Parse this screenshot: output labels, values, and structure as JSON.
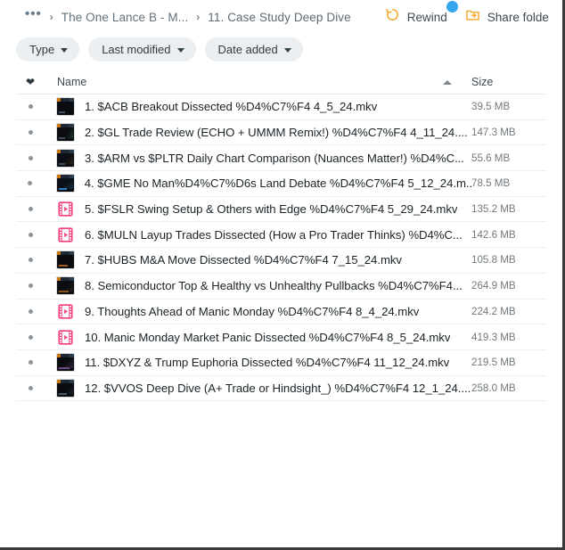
{
  "breadcrumb": {
    "overflow_icon": "ellipsis-icon",
    "separator": "›",
    "items": [
      {
        "label": "The One Lance B - M..."
      },
      {
        "label": "11. Case Study Deep Dive"
      }
    ]
  },
  "toolbar": {
    "rewind": {
      "label": "Rewind",
      "icon": "rewind-circular-arrow-icon",
      "color": "#F5A623",
      "has_badge": true,
      "badge_color": "#35A6EF"
    },
    "share_folder": {
      "label": "Share folde",
      "icon": "share-folder-icon",
      "color": "#F5A623"
    }
  },
  "filters": [
    {
      "label": "Type",
      "icon": "chevron-down-icon"
    },
    {
      "label": "Last modified",
      "icon": "chevron-down-icon"
    },
    {
      "label": "Date added",
      "icon": "chevron-down-icon"
    }
  ],
  "table": {
    "columns": {
      "favorite_icon": "heart-icon",
      "name": "Name",
      "sort_icon": "chevron-up-icon",
      "size": "Size"
    },
    "rows": [
      {
        "name": "1. $ACB Breakout Dissected %D4%C7%F4 4_5_24.mkv",
        "size": "39.5 MB",
        "icon": "video-thumbnail",
        "variant": "v1"
      },
      {
        "name": "2. $GL Trade Review (ECHO + UMMM Remix!) %D4%C7%F4 4_11_24....",
        "size": "147.3 MB",
        "icon": "video-thumbnail",
        "variant": "v2"
      },
      {
        "name": "3. $ARM vs $PLTR Daily Chart Comparison (Nuances Matter!) %D4%C...",
        "size": "55.6 MB",
        "icon": "video-thumbnail",
        "variant": "v3"
      },
      {
        "name": "4. $GME No Man%D4%C7%D6s Land Debate %D4%C7%F4 5_12_24.m...",
        "size": "78.5 MB",
        "icon": "video-thumbnail",
        "variant": "v4"
      },
      {
        "name": "5. $FSLR Swing Setup & Others with Edge %D4%C7%F4 5_29_24.mkv",
        "size": "135.2 MB",
        "icon": "video-file-icon",
        "variant": "film"
      },
      {
        "name": "6. $MULN Layup Trades Dissected (How a Pro Trader Thinks) %D4%C...",
        "size": "142.6 MB",
        "icon": "video-file-icon",
        "variant": "film"
      },
      {
        "name": "7. $HUBS M&A Move Dissected %D4%C7%F4 7_15_24.mkv",
        "size": "105.8 MB",
        "icon": "video-thumbnail",
        "variant": "v7"
      },
      {
        "name": "8. Semiconductor Top & Healthy vs Unhealthy Pullbacks %D4%C7%F4...",
        "size": "264.9 MB",
        "icon": "video-thumbnail",
        "variant": "v8"
      },
      {
        "name": "9. Thoughts Ahead of Manic Monday %D4%C7%F4 8_4_24.mkv",
        "size": "224.2 MB",
        "icon": "video-file-icon",
        "variant": "film"
      },
      {
        "name": "10. Manic Monday Market Panic Dissected %D4%C7%F4 8_5_24.mkv",
        "size": "419.3 MB",
        "icon": "video-file-icon",
        "variant": "film"
      },
      {
        "name": "11. $DXYZ & Trump Euphoria Dissected %D4%C7%F4 11_12_24.mkv",
        "size": "219.5 MB",
        "icon": "video-thumbnail",
        "variant": "v11"
      },
      {
        "name": "12. $VVOS Deep Dive (A+ Trade or Hindsight_) %D4%C7%F4 12_1_24....",
        "size": "258.0 MB",
        "icon": "video-thumbnail",
        "variant": "v12"
      }
    ]
  }
}
